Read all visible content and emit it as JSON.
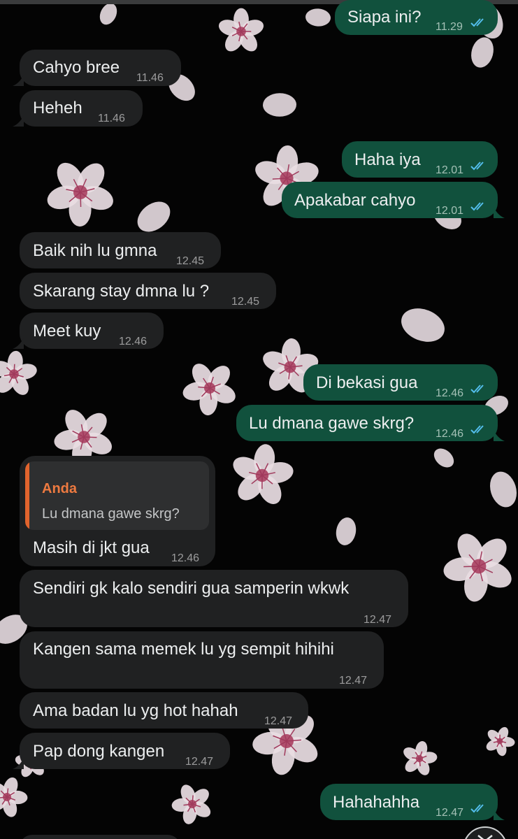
{
  "wallpaper": {
    "style": "black background with white-pink cherry blossom flowers and petals"
  },
  "colors": {
    "incoming_bubble": "#202122",
    "outgoing_bubble": "#11513d",
    "message_text": "#eceeef",
    "read_ticks": "#53bdeb",
    "quote_accent": "#e0632d"
  },
  "messages": [
    {
      "dir": "out",
      "text": "Siapa ini?",
      "time": "11.29",
      "status": "read"
    },
    {
      "dir": "in",
      "text": "Cahyo bree",
      "time": "11.46"
    },
    {
      "dir": "in",
      "text": "Heheh",
      "time": "11.46"
    },
    {
      "dir": "out",
      "text": "Haha iya",
      "time": "12.01",
      "status": "read"
    },
    {
      "dir": "out",
      "text": "Apakabar cahyo",
      "time": "12.01",
      "status": "read"
    },
    {
      "dir": "in",
      "text": "Baik nih lu gmna",
      "time": "12.45"
    },
    {
      "dir": "in",
      "text": "Skarang stay dmna lu ?",
      "time": "12.45"
    },
    {
      "dir": "in",
      "text": "Meet kuy",
      "time": "12.46"
    },
    {
      "dir": "out",
      "text": "Di bekasi gua",
      "time": "12.46",
      "status": "read"
    },
    {
      "dir": "out",
      "text": "Lu dmana gawe skrg?",
      "time": "12.46",
      "status": "read"
    },
    {
      "dir": "in",
      "text": "Masih di jkt gua",
      "time": "12.46",
      "quote": {
        "author": "Anda",
        "text": "Lu dmana gawe skrg?"
      }
    },
    {
      "dir": "in",
      "text": "Sendiri gk kalo sendiri gua samperin wkwk",
      "time": "12.47"
    },
    {
      "dir": "in",
      "text": "Kangen sama memek lu yg sempit hihihi",
      "time": "12.47"
    },
    {
      "dir": "in",
      "text": "Ama badan lu yg hot hahah",
      "time": "12.47"
    },
    {
      "dir": "in",
      "text": "Pap dong kangen",
      "time": "12.47"
    },
    {
      "dir": "out",
      "text": "Hahahahha",
      "time": "12.47",
      "status": "read"
    }
  ],
  "scroll_button": {
    "icon": "chevron-down-icon"
  }
}
